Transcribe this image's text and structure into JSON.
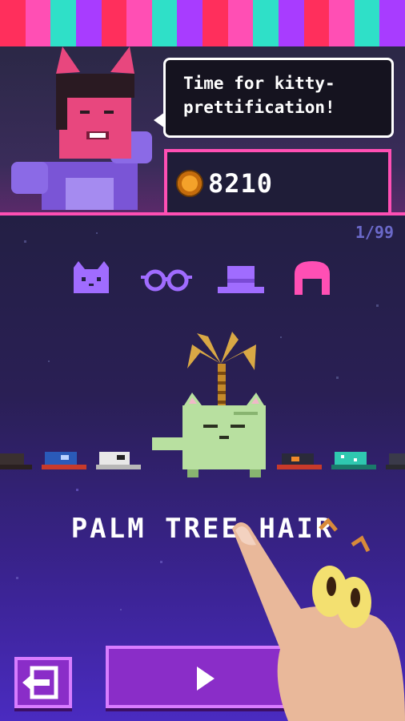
{
  "colors": {
    "awning": [
      "#ff2f5c",
      "#ff4fb4",
      "#2fe0c8",
      "#a83cff",
      "#ff2f5c",
      "#ff4fb4",
      "#2fe0c8",
      "#a83cff",
      "#ff2f5c",
      "#ff4fb4",
      "#2fe0c8",
      "#a83cff",
      "#ff2f5c",
      "#ff4fb4",
      "#2fe0c8",
      "#a83cff"
    ],
    "accent": "#ff4fb4",
    "tab_inactive": "#a06cff",
    "tab_active": "#ff4fb4",
    "button": "#8a2dc8"
  },
  "speech": {
    "line1": "Time for kitty-",
    "line2": "prettification!"
  },
  "currency": {
    "icon": "coin-icon",
    "amount": "8210"
  },
  "page_counter": "1/99",
  "tabs": [
    {
      "name": "cat-color",
      "icon": "cat-face-icon",
      "active": false
    },
    {
      "name": "glasses",
      "icon": "glasses-icon",
      "active": false
    },
    {
      "name": "hats",
      "icon": "hat-icon",
      "active": false
    },
    {
      "name": "hair",
      "icon": "hair-icon",
      "active": true
    }
  ],
  "selected_item": {
    "name": "PALM TREE HAIR"
  },
  "buttons": {
    "back": "exit-icon",
    "play": "play-icon"
  }
}
